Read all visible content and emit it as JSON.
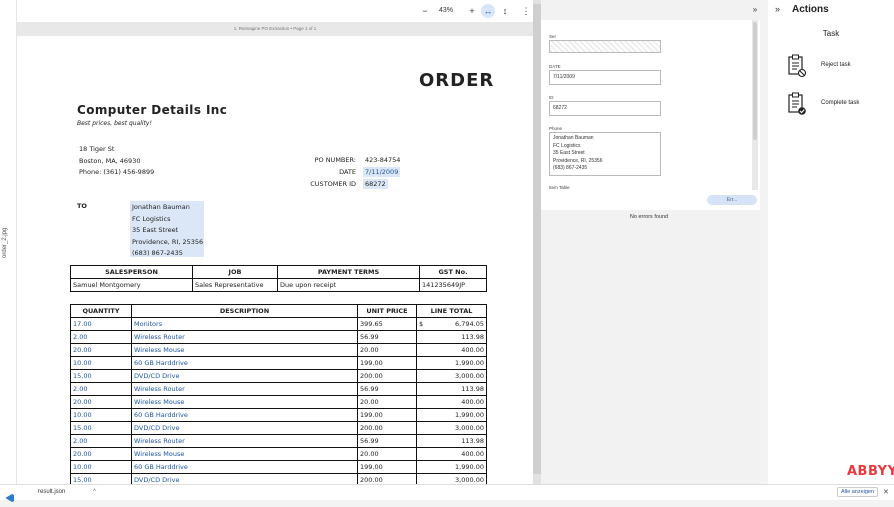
{
  "file_tab": "order_2.jpg",
  "viewer": {
    "zoom": "43%",
    "zoom_out": "−",
    "zoom_in": "+",
    "page_caption": "1. Reimagine PO Extraction • Page 1 of 1"
  },
  "document": {
    "title": "ORDER",
    "company": "Computer Details Inc",
    "tagline": "Best prices, best quality!",
    "address1": "18 Tiger St",
    "address2": "Boston, MA, 46930",
    "phone": "Phone: (361) 456-9899",
    "po_label": "PO NUMBER:",
    "po_value": "423-84754",
    "date_label": "DATE",
    "date_value": "7/11/2009",
    "cust_label": "CUSTOMER ID",
    "cust_value": "68272",
    "to_label": "TO",
    "to_lines": [
      "Jonathan Bauman",
      "FC Logistics",
      "35 East Street",
      "Providence, RI, 25356",
      "(683) 867-2435"
    ],
    "info_headers": [
      "SALESPERSON",
      "JOB",
      "PAYMENT TERMS",
      "GST No."
    ],
    "info_values": [
      "Samuel Montgomery",
      "Sales Representative",
      "Due upon receipt",
      "141235649JP"
    ],
    "item_headers": [
      "QUANTITY",
      "DESCRIPTION",
      "UNIT PRICE",
      "LINE TOTAL"
    ],
    "currency": "$",
    "items": [
      [
        "17.00",
        "Monitors",
        "399.65",
        "6,794.05"
      ],
      [
        "2.00",
        "Wireless Router",
        "56.99",
        "113.98"
      ],
      [
        "20.00",
        "Wireless Mouse",
        "20.00",
        "400.00"
      ],
      [
        "10.00",
        "60 GB Harddrive",
        "199.00",
        "1,990.00"
      ],
      [
        "15.00",
        "DVD/CD Drive",
        "200.00",
        "3,000.00"
      ],
      [
        "2.00",
        "Wireless Router",
        "56.99",
        "113.98"
      ],
      [
        "20.00",
        "Wireless Mouse",
        "20.00",
        "400.00"
      ],
      [
        "10.00",
        "60 GB Harddrive",
        "199.00",
        "1,990.00"
      ],
      [
        "15.00",
        "DVD/CD Drive",
        "200.00",
        "3,000.00"
      ],
      [
        "2.00",
        "Wireless Router",
        "56.99",
        "113.98"
      ],
      [
        "20.00",
        "Wireless Mouse",
        "20.00",
        "400.00"
      ],
      [
        "10.00",
        "60 GB Harddrive",
        "199.00",
        "1,990.00"
      ],
      [
        "15.00",
        "DVD/CD Drive",
        "200.00",
        "3,000.00"
      ]
    ]
  },
  "fields": {
    "f1_label": "Ser",
    "date_label": "DATE",
    "date_value": "7/11/2009",
    "id_label": "ID",
    "id_value": "68272",
    "phone_label": "Phone",
    "phone_value": [
      "Jonathan Bauman",
      "FC Logistics",
      "35 East Street",
      "Providence, RI, 25356",
      "(683) 867-2435"
    ],
    "next_label": "Item Table",
    "errors_button": "Err...",
    "no_errors": "No errors found"
  },
  "actions": {
    "collapse": "»",
    "title": "Actions",
    "task_title": "Task",
    "reject": "Reject task",
    "complete": "Complete task"
  },
  "bottom": {
    "file": "result.json",
    "chevron": "^",
    "show_all": "Alle anzeigen",
    "close": "✕"
  },
  "brand": "ABBYY",
  "colors": {
    "accent": "#1f55a5",
    "brand": "#e8393e"
  }
}
